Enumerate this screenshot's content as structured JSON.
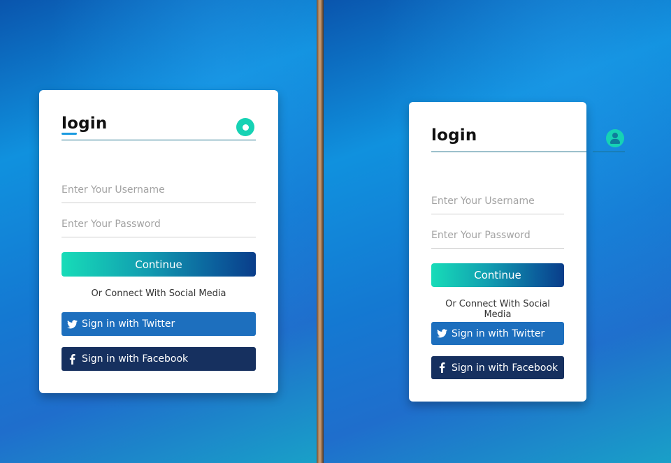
{
  "cards": [
    {
      "title": "login",
      "username_placeholder": "Enter Your Username",
      "password_placeholder": "Enter Your Password",
      "continue_label": "Continue",
      "social_text": "Or Connect With Social Media",
      "twitter_label": "Sign in with Twitter",
      "facebook_label": "Sign in with Facebook"
    },
    {
      "title": "login",
      "username_placeholder": "Enter Your Username",
      "password_placeholder": "Enter Your Password",
      "continue_label": "Continue",
      "social_text": "Or Connect With Social Media",
      "twitter_label": "Sign in with Twitter",
      "facebook_label": "Sign in with Facebook"
    }
  ],
  "icons": {
    "avatar_left": "profile-dot-icon",
    "avatar_right": "user-icon",
    "twitter": "twitter-bird-icon",
    "facebook": "facebook-f-icon"
  },
  "colors": {
    "accent_teal": "#16d2b4",
    "twitter_button": "#1d6fbe",
    "facebook_button": "#16305f",
    "continue_gradient_start": "#17dcb8",
    "continue_gradient_end": "#0a3d8a"
  }
}
